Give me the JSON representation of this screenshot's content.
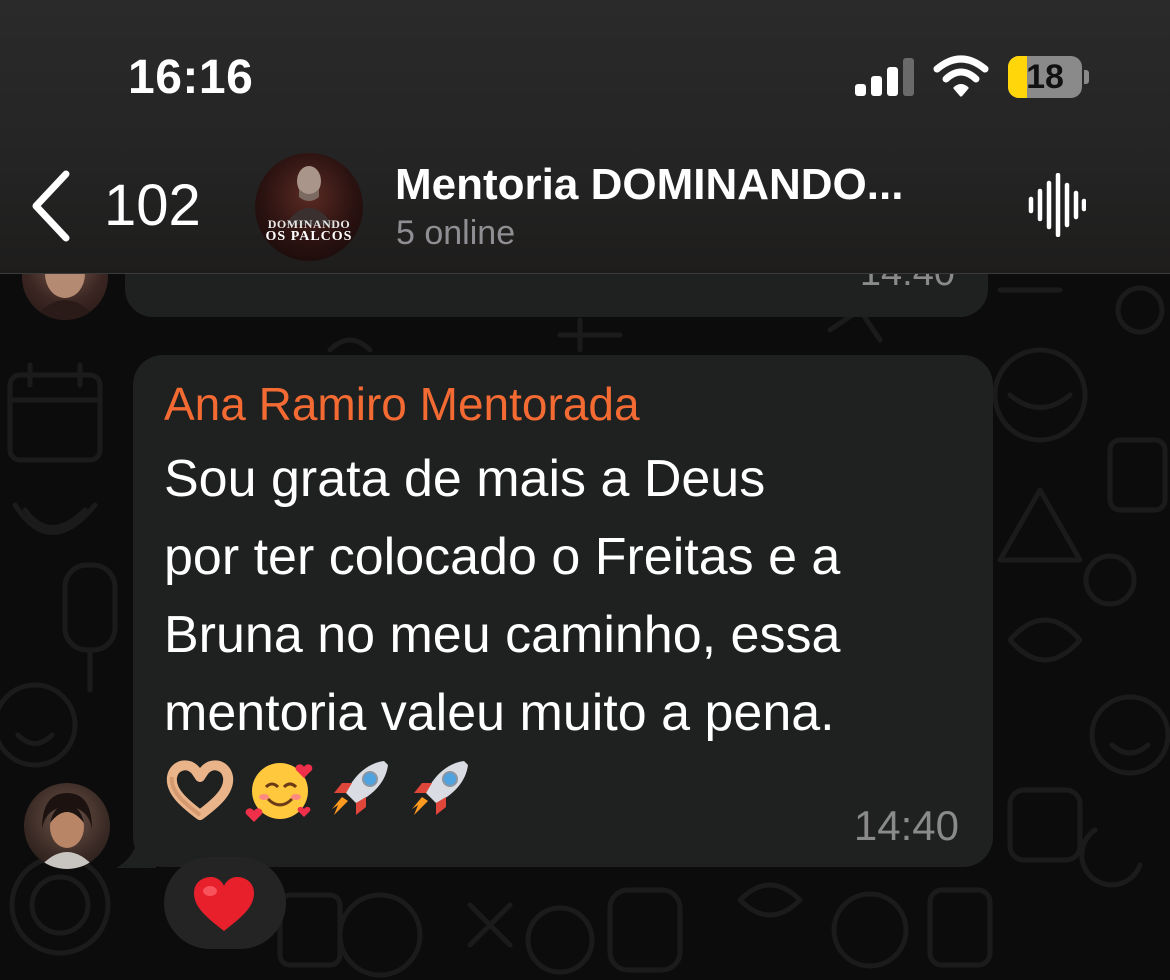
{
  "status_bar": {
    "time": "16:16",
    "battery_level": "18",
    "battery_fill_percent": 18,
    "icons": [
      "signal-icon",
      "wifi-icon",
      "battery-icon"
    ]
  },
  "header": {
    "back_count": "102",
    "chat_title": "Mentoria DOMINANDO...",
    "subtitle": "5 online",
    "avatar_text_line1": "DOMINANDO",
    "avatar_text_line2": "OS PALCOS",
    "icons": [
      "back-chevron-icon",
      "voice-chat-icon"
    ]
  },
  "previous_message": {
    "time": "14:40"
  },
  "message": {
    "sender": "Ana Ramiro Mentorada",
    "lines": [
      "Sou grata de mais a Deus",
      "por ter colocado o Freitas e a",
      "Bruna no meu caminho, essa",
      "mentoria valeu muito a pena."
    ],
    "emojis": [
      "heart-hands-emoji",
      "smiling-face-with-hearts-emoji",
      "rocket-emoji",
      "rocket-emoji"
    ],
    "time": "14:40"
  },
  "reaction": {
    "emoji": "red-heart-emoji"
  },
  "colors": {
    "sender_name": "#f36b33",
    "bubble": "#1f2020",
    "battery_accent": "#ffd60a",
    "subtitle": "#8e8e93"
  }
}
